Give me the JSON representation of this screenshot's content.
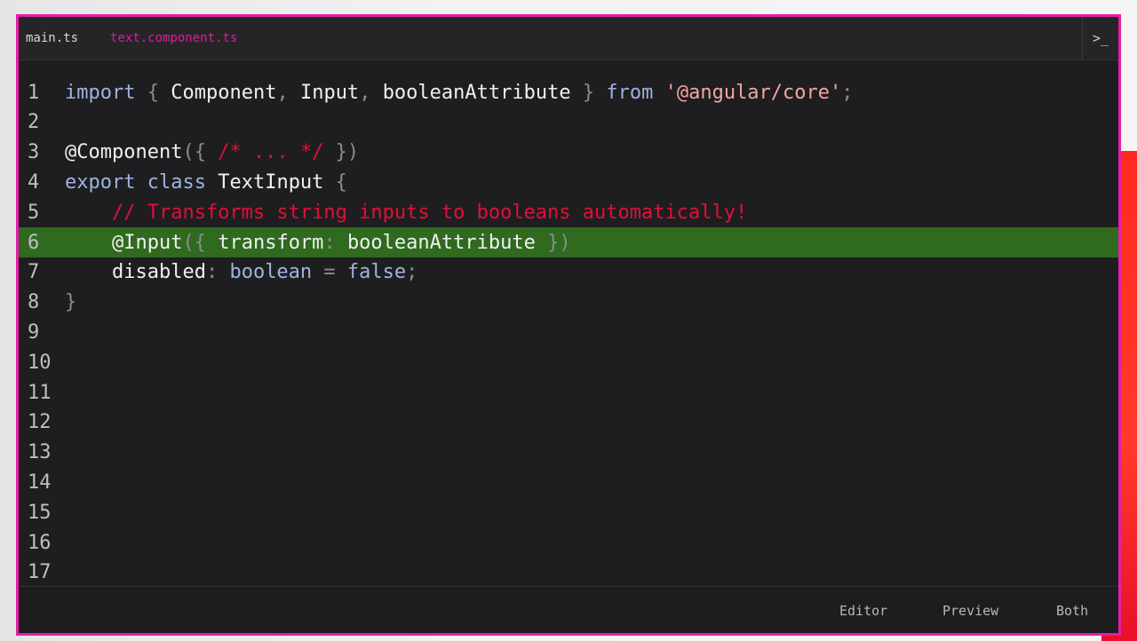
{
  "tabs": [
    {
      "label": "main.ts",
      "active": false
    },
    {
      "label": "text.component.ts",
      "active": true
    }
  ],
  "terminal_icon": "terminal-icon",
  "code_lines": [
    {
      "n": "1",
      "tokens": [
        [
          "kw",
          "import"
        ],
        [
          "pn",
          " { "
        ],
        [
          "id",
          "Component"
        ],
        [
          "pn",
          ", "
        ],
        [
          "id",
          "Input"
        ],
        [
          "pn",
          ", "
        ],
        [
          "id",
          "booleanAttribute"
        ],
        [
          "pn",
          " } "
        ],
        [
          "kw",
          "from"
        ],
        [
          "pn",
          " "
        ],
        [
          "str",
          "'@angular/core'"
        ],
        [
          "pn",
          ";"
        ]
      ]
    },
    {
      "n": "2",
      "tokens": []
    },
    {
      "n": "3",
      "tokens": [
        [
          "id",
          "@Component"
        ],
        [
          "pn",
          "({ "
        ],
        [
          "cm",
          "/* ... */"
        ],
        [
          "pn",
          " })"
        ]
      ]
    },
    {
      "n": "4",
      "tokens": [
        [
          "kw",
          "export"
        ],
        [
          "pn",
          " "
        ],
        [
          "kw",
          "class"
        ],
        [
          "pn",
          " "
        ],
        [
          "id",
          "TextInput"
        ],
        [
          "pn",
          " {"
        ]
      ]
    },
    {
      "n": "5",
      "tokens": [
        [
          "pn",
          "    "
        ],
        [
          "cm",
          "// Transforms string inputs to booleans automatically!"
        ]
      ]
    },
    {
      "n": "6",
      "tokens": [
        [
          "pn",
          "    "
        ],
        [
          "id",
          "@Input"
        ],
        [
          "pn",
          "({ "
        ],
        [
          "id",
          "transform"
        ],
        [
          "pn",
          ": "
        ],
        [
          "id",
          "booleanAttribute"
        ],
        [
          "pn",
          " })"
        ]
      ],
      "highlight": true
    },
    {
      "n": "7",
      "tokens": [
        [
          "pn",
          "    "
        ],
        [
          "id",
          "disabled"
        ],
        [
          "pn",
          ": "
        ],
        [
          "kw",
          "boolean"
        ],
        [
          "pn",
          " = "
        ],
        [
          "kw",
          "false"
        ],
        [
          "pn",
          ";"
        ]
      ]
    },
    {
      "n": "8",
      "tokens": [
        [
          "pn",
          "}"
        ]
      ]
    },
    {
      "n": "9",
      "tokens": []
    },
    {
      "n": "10",
      "tokens": []
    },
    {
      "n": "11",
      "tokens": []
    },
    {
      "n": "12",
      "tokens": []
    },
    {
      "n": "13",
      "tokens": []
    },
    {
      "n": "14",
      "tokens": []
    },
    {
      "n": "15",
      "tokens": []
    },
    {
      "n": "16",
      "tokens": []
    },
    {
      "n": "17",
      "tokens": []
    }
  ],
  "view_modes": [
    "Editor",
    "Preview",
    "Both"
  ],
  "colors": {
    "accent": "#e61ea6",
    "highlight": "#2f6a1f",
    "comment": "#e0103a"
  }
}
